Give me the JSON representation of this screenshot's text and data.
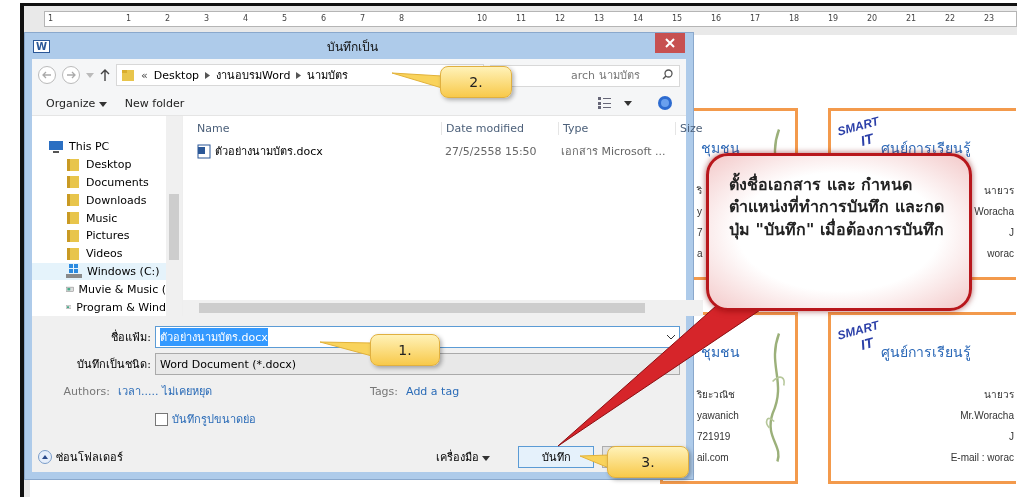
{
  "ruler": {
    "numbers": [
      "1",
      "1",
      "2",
      "3",
      "4",
      "5",
      "6",
      "7",
      "8",
      "10",
      "11",
      "12",
      "13",
      "14",
      "15",
      "16",
      "17",
      "18",
      "19",
      "20",
      "21",
      "22",
      "23"
    ]
  },
  "cards": [
    {
      "kind": "vine",
      "title": "ชุมชน",
      "lines": [
        "ริ",
        "y",
        "7",
        "a"
      ]
    },
    {
      "kind": "logo",
      "logo": [
        "SMART",
        "IT"
      ],
      "title": "ศูนย์การเรียนรู้",
      "lines": [
        "นายวร",
        "Woracha",
        "J",
        "worac"
      ]
    },
    {
      "kind": "vine",
      "title": "ชุมชน",
      "lines": [
        "ริยะวณิช",
        "yawanich",
        "721919",
        "ail.com"
      ]
    },
    {
      "kind": "logo",
      "logo": [
        "SMART",
        "IT"
      ],
      "title": "ศูนย์การเรียนรู้",
      "lines": [
        "นายวร",
        "Mr.Woracha",
        "J",
        "E-mail : worac"
      ]
    }
  ],
  "dialog": {
    "title": "บันทึกเป็น",
    "app_icon": "W",
    "address": {
      "overflow": "«",
      "crumbs": [
        "Desktop",
        "งานอบรมWord",
        "นามบัตร"
      ]
    },
    "search": {
      "placeholder": "arch นามบัตร"
    },
    "toolbar": [
      "Organize",
      "New folder"
    ],
    "nav": [
      {
        "kind": "pc",
        "label": "This PC",
        "selected": false
      },
      {
        "kind": "folder",
        "label": "Desktop",
        "selected": false
      },
      {
        "kind": "folder",
        "label": "Documents",
        "selected": false
      },
      {
        "kind": "folder",
        "label": "Downloads",
        "selected": false
      },
      {
        "kind": "folder",
        "label": "Music",
        "selected": false
      },
      {
        "kind": "folder",
        "label": "Pictures",
        "selected": false
      },
      {
        "kind": "folder",
        "label": "Videos",
        "selected": false
      },
      {
        "kind": "drive",
        "label": "Windows (C:)",
        "selected": true
      },
      {
        "kind": "disc",
        "label": "Muvie & Music (",
        "selected": false
      },
      {
        "kind": "disc",
        "label": "Program & Wind",
        "selected": false
      }
    ],
    "columns": [
      "Name",
      "Date modified",
      "Type",
      "Size"
    ],
    "files": [
      {
        "name": "ตัวอย่างนามบัตร.docx",
        "date": "27/5/2558 15:50",
        "type": "เอกสาร Microsoft ..."
      }
    ],
    "filename": {
      "label": "ชื่อแฟ้ม:",
      "value": "ตัวอย่างนามบัตร.docx"
    },
    "filetype": {
      "label": "บันทึกเป็นชนิด:",
      "value": "Word Document (*.docx)"
    },
    "authors": {
      "label": "Authors:",
      "value": "เวลา..... ไม่เคยหยุด"
    },
    "tags": {
      "label": "Tags:",
      "value": "Add a tag"
    },
    "thumbnail": {
      "label": "บันทึกรูปขนาดย่อ",
      "checked": false
    },
    "hide_folders": "ซ่อนโฟลเดอร์",
    "tools": "เครื่องมือ",
    "save": "บันทึก"
  },
  "callouts": [
    {
      "label": "2."
    },
    {
      "label": "1."
    },
    {
      "label": "3."
    }
  ],
  "note": "ตั้งชื่อเอกสาร และ กำหนดตำแหน่งที่ทำการบันทึก และกดปุ่ม \"บันทึก\" เมื่อต้องการบันทึก"
}
